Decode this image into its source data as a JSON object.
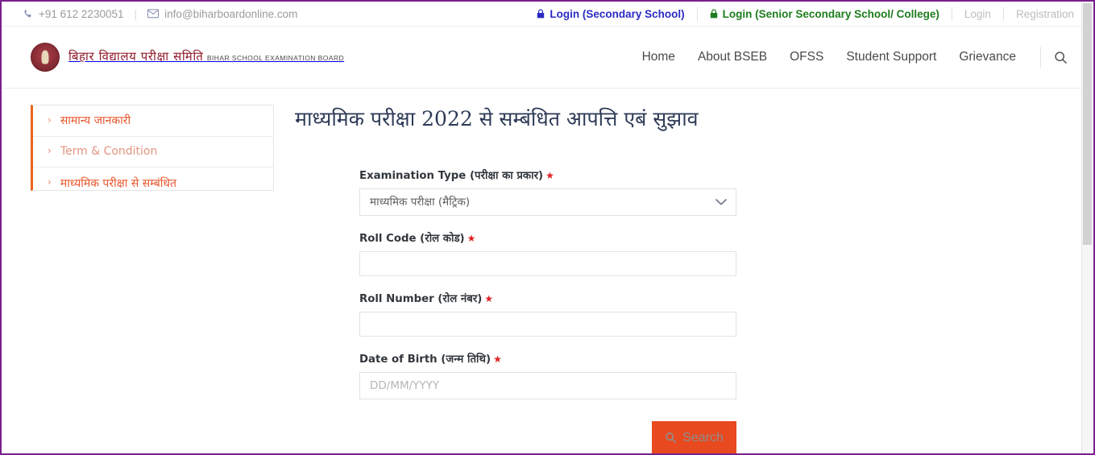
{
  "topbar": {
    "phone": "+91 612 2230051",
    "email": "info@biharboardonline.com",
    "phone_icon": "phone-icon",
    "email_icon": "envelope-icon",
    "login_secondary": "Login (Secondary School)",
    "login_senior": "Login (Senior Secondary School/ College)",
    "login": "Login",
    "registration": "Registration",
    "lock_icon": "lock-icon",
    "color_secondary": "#2b2bc4",
    "color_senior": "#1e7d1e"
  },
  "header": {
    "brand_hindi": "बिहार विद्यालय परीक्षा समिति",
    "brand_english": "BIHAR SCHOOL EXAMINATION BOARD",
    "seal_icon": "bseb-seal-logo",
    "search_icon": "search-icon",
    "nav": [
      {
        "label": "Home"
      },
      {
        "label": "About BSEB"
      },
      {
        "label": "OFSS"
      },
      {
        "label": "Student Support"
      },
      {
        "label": "Grievance"
      }
    ]
  },
  "sidebar": {
    "accent_color": "#e8641f",
    "items": [
      {
        "label": "सामान्य जानकारी",
        "icon": "chevron-right-icon",
        "muted": false
      },
      {
        "label": "Term & Condition",
        "icon": "chevron-right-icon",
        "muted": true
      },
      {
        "label": "माध्यमिक परीक्षा से सम्बंधित",
        "icon": "chevron-right-icon",
        "muted": false
      }
    ]
  },
  "main": {
    "title": "माध्यमिक परीक्षा 2022 से सम्बंधित आपत्ति एबं सुझाव",
    "form": {
      "exam_type": {
        "label": "Examination Type (परीक्षा का प्रकार)",
        "required_mark": "★",
        "value": "माध्यमिक परीक्षा (मैट्रिक)",
        "chevron_icon": "chevron-down-icon"
      },
      "roll_code": {
        "label": "Roll Code (रोल कोड)",
        "required_mark": "★",
        "value": "",
        "placeholder": ""
      },
      "roll_number": {
        "label": "Roll Number (रोल नंबर)",
        "required_mark": "★",
        "value": "",
        "placeholder": ""
      },
      "dob": {
        "label": "Date of Birth (जन्म तिथि)",
        "required_mark": "★",
        "value": "",
        "placeholder": "DD/MM/YYYY"
      },
      "search_button": {
        "label": "Search",
        "icon": "search-icon",
        "bg_color": "#e8491f",
        "text_color": "#8e8e8e"
      }
    }
  },
  "frame": {
    "border_color": "#7b1f8f"
  }
}
